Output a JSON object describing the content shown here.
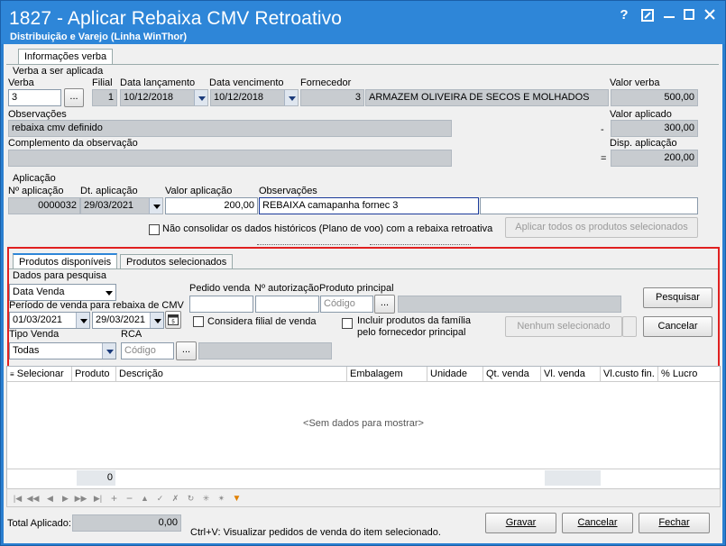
{
  "window": {
    "title": "1827 - Aplicar Rebaixa CMV Retroativo",
    "subtitle": "Distribuição e Varejo (Linha WinThor)",
    "help": "?",
    "restore": "⤢",
    "minimize": "—",
    "maximize": "☐",
    "close": "✕"
  },
  "tabs": {
    "info": "Informações verba"
  },
  "verba": {
    "section": "Verba a ser aplicada",
    "verba_label": "Verba",
    "verba_value": "3",
    "browse": "...",
    "filial_label": "Filial",
    "filial_value": "1",
    "data_lanc_label": "Data lançamento",
    "data_lanc_value": "10/12/2018",
    "data_venc_label": "Data vencimento",
    "data_venc_value": "10/12/2018",
    "fornecedor_label": "Fornecedor",
    "fornecedor_code": "3",
    "fornecedor_name": "ARMAZEM OLIVEIRA DE SECOS E MOLHADOS",
    "valor_verba_label": "Valor verba",
    "valor_verba_value": "500,00",
    "obs_label": "Observações",
    "obs_value": "rebaixa cmv definido",
    "valor_aplicado_label": "Valor aplicado",
    "minus": "-",
    "valor_aplicado_value": "300,00",
    "complemento_label": "Complemento da observação",
    "complemento_value": "",
    "disp_label": "Disp. aplicação",
    "equals": "=",
    "disp_value": "200,00"
  },
  "aplicacao": {
    "section": "Aplicação",
    "num_label": "Nº aplicação",
    "num_value": "0000032",
    "dt_label": "Dt. aplicação",
    "dt_value": "29/03/2021",
    "valor_label": "Valor aplicação",
    "valor_value": "200,00",
    "obs_label": "Observações",
    "obs_value": "REBAIXA camapanha fornec 3",
    "obs_extra": "",
    "nao_consolidar": "Não consolidar os dados históricos (Plano de voo) com a rebaixa retroativa",
    "aplicar_todos": "Aplicar todos os produtos selecionados"
  },
  "search_tabs": {
    "disponiveis": "Produtos disponíveis",
    "selecionados": "Produtos selecionados"
  },
  "pesquisa": {
    "section": "Dados para pesquisa",
    "tipo_value": "Data Venda",
    "periodo_label": "Período de venda para rebaixa de CMV",
    "data_ini": "01/03/2021",
    "data_fim": "29/03/2021",
    "pedido_label": "Pedido venda",
    "pedido_value": "",
    "autorizacao_label": "Nº autorização",
    "autorizacao_value": "",
    "produto_label": "Produto principal",
    "produto_placeholder": "Código",
    "produto_desc": "",
    "considera_filial": "Considera filial de venda",
    "incluir_familia_1": "Incluir produtos da família",
    "incluir_familia_2": "pelo fornecedor principal",
    "tipo_venda_label": "Tipo Venda",
    "tipo_venda_value": "Todas",
    "rca_label": "RCA",
    "rca_placeholder": "Código",
    "rca_desc": "",
    "nenhum": "Nenhum selecionado",
    "pesquisar": "Pesquisar",
    "cancelar": "Cancelar"
  },
  "grid": {
    "columns": [
      "Selecionar",
      "Produto",
      "Descrição",
      "Embalagem",
      "Unidade",
      "Qt. venda",
      "Vl. venda",
      "Vl.custo fin.",
      "% Lucro"
    ],
    "empty": "<Sem dados para mostrar>",
    "footer_count": "0"
  },
  "footer": {
    "total_label": "Total Aplicado:",
    "total_value": "0,00",
    "hint": "Ctrl+V: Visualizar pedidos de venda do item selecionado.",
    "gravar": "Gravar",
    "cancelar": "Cancelar",
    "fechar": "Fechar"
  },
  "colors": {
    "title_bar": "#2e86d8",
    "highlight_border": "#e02020",
    "readonly_bg": "#c8ccd0"
  }
}
